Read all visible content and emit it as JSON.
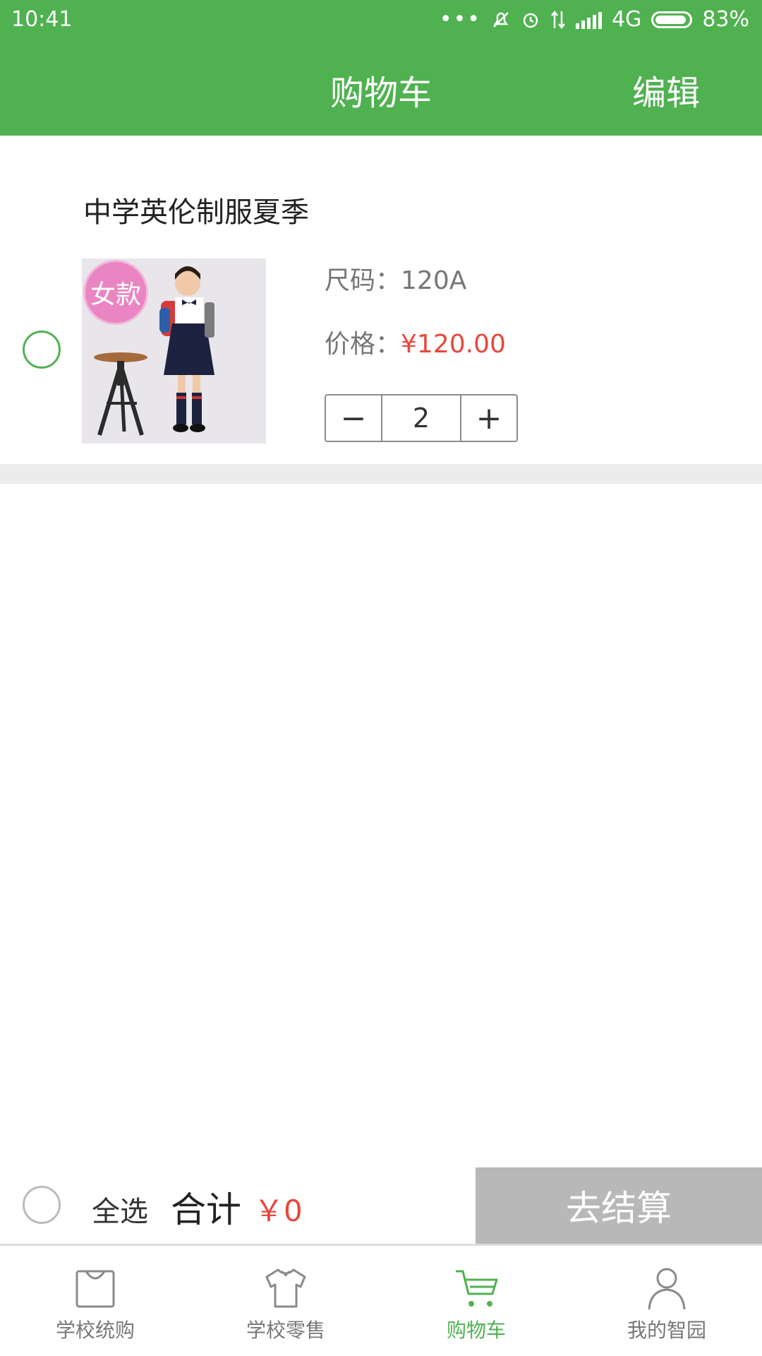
{
  "status_bar": {
    "time": "10:41",
    "network": "4G",
    "battery": "83%"
  },
  "header": {
    "title": "购物车",
    "edit_label": "编辑"
  },
  "cart": {
    "items": [
      {
        "name": "中学英伦制服夏季",
        "badge": "女款",
        "size_label": "尺码：",
        "size_value": "120A",
        "price_label": "价格：",
        "price_value": "¥120.00",
        "quantity": "2",
        "selected": false
      }
    ]
  },
  "stepper": {
    "minus": "−",
    "plus": "+"
  },
  "summary": {
    "select_all_label": "全选",
    "total_label": "合计",
    "total_value": "￥0",
    "checkout_label": "去结算"
  },
  "tabs": [
    {
      "label": "学校统购",
      "icon": "shopping-bag-icon",
      "active": false
    },
    {
      "label": "学校零售",
      "icon": "tshirt-icon",
      "active": false
    },
    {
      "label": "购物车",
      "icon": "cart-icon",
      "active": true
    },
    {
      "label": "我的智园",
      "icon": "user-icon",
      "active": false
    }
  ],
  "colors": {
    "accent": "#50b151",
    "price": "#e8473d",
    "checkout_disabled": "#b8b8b8",
    "badge": "#e985c2"
  }
}
